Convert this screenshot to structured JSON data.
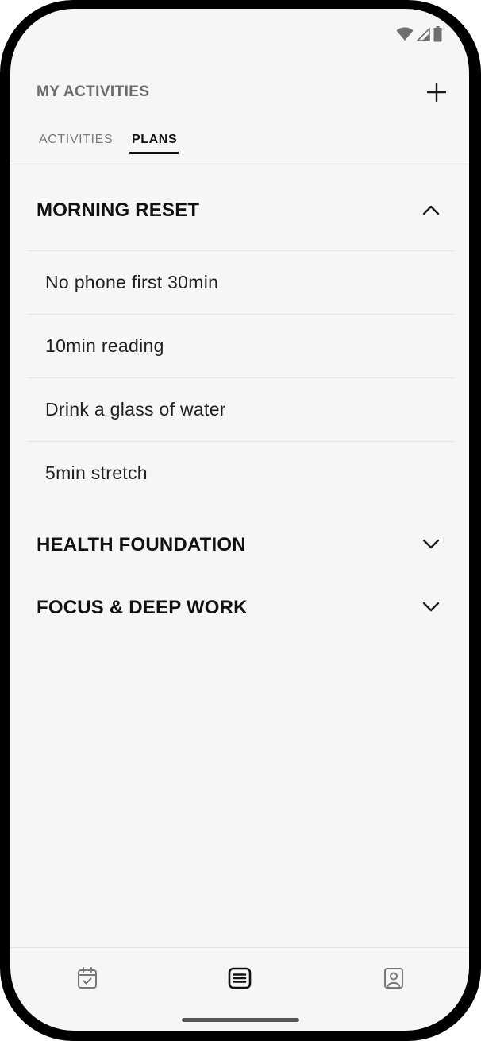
{
  "header": {
    "title": "MY ACTIVITIES"
  },
  "tabs": [
    {
      "label": "ACTIVITIES",
      "selected": false
    },
    {
      "label": "PLANS",
      "selected": true
    }
  ],
  "plans": [
    {
      "title": "MORNING RESET",
      "expanded": true,
      "items": [
        {
          "label": "No phone first 30min"
        },
        {
          "label": "10min reading"
        },
        {
          "label": "Drink a glass of water"
        },
        {
          "label": "5min stretch"
        }
      ]
    },
    {
      "title": "HEALTH FOUNDATION",
      "expanded": false,
      "items": []
    },
    {
      "title": "FOCUS & DEEP WORK",
      "expanded": false,
      "items": []
    }
  ],
  "bottom_nav": {
    "items": [
      {
        "icon": "calendar-check-icon",
        "selected": false
      },
      {
        "icon": "list-icon",
        "selected": true
      },
      {
        "icon": "profile-icon",
        "selected": false
      }
    ]
  },
  "status_bar": {
    "icons": [
      "wifi-icon",
      "cell-signal-icon",
      "battery-icon"
    ]
  },
  "colors": {
    "background": "#f6f6f6",
    "text_primary": "#111111",
    "text_muted": "#6b6b6b",
    "divider": "#e0e0e0"
  }
}
